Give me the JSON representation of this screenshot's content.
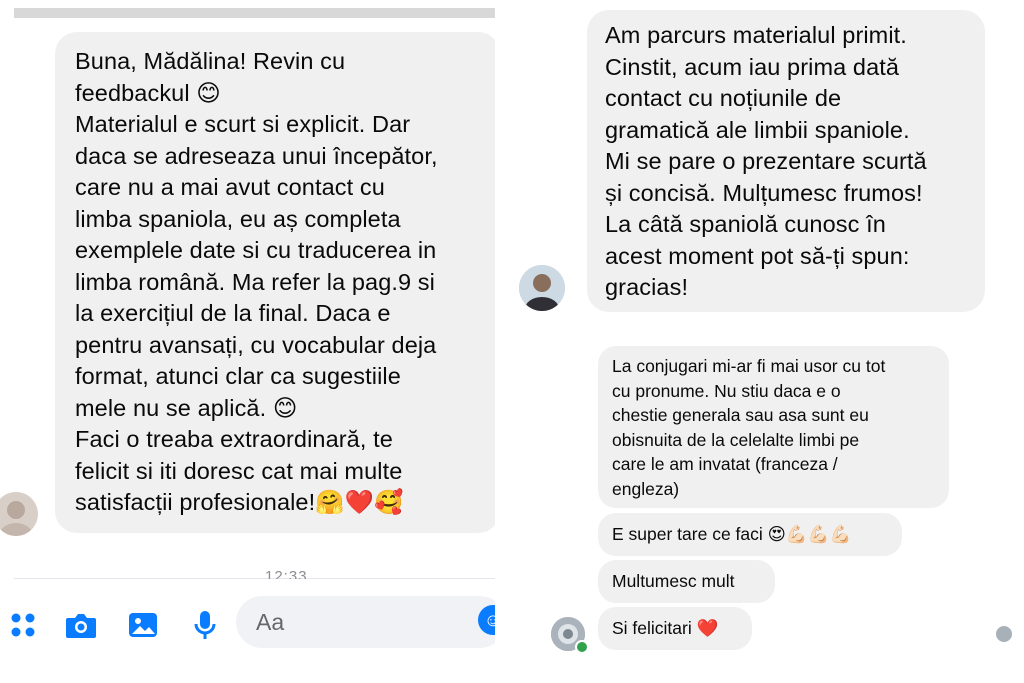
{
  "left_panel": {
    "message": "Buna, Mădălina! Revin cu\nfeedbackul 😊\nMaterialul e scurt si explicit. Dar\ndaca se adreseaza unui începător,\ncare nu a mai avut contact cu\nlimba spaniola, eu aș completa\nexemplele date si cu traducerea in\nlimba română. Ma refer la pag.9 si\nla exercițiul de la final. Daca e\npentru avansați, cu vocabular deja\nformat, atunci clar ca sugestiile\nmele nu se aplică. 😊\nFaci o treaba extraordinară, te\nfelicit si iti doresc cat mai multe\nsatisfacții profesionale!🤗❤️🥰",
    "timestamp": "12:33",
    "composer": {
      "placeholder": "Aa"
    },
    "toolbar_icons": [
      "apps-icon",
      "camera-icon",
      "image-icon",
      "microphone-icon",
      "emoji-icon"
    ]
  },
  "right_panel": {
    "message": "Am parcurs materialul primit.\nCinstit, acum iau prima dată\ncontact cu noțiunile de\ngramatică ale limbii spaniole.\nMi se pare o prezentare scurtă\nși concisă. Mulțumesc frumos!\nLa câtă spaniolă cunosc în\nacest moment pot să-ți spun:\ngracias!",
    "messages": [
      "La conjugari mi-ar fi mai usor cu tot\ncu pronume. Nu stiu daca e o\nchestie generala sau asa sunt eu\nobisnuita de la celelalte limbi pe\ncare le am invatat (franceza /\nengleza)",
      "E super tare ce faci 😍💪🏻💪🏻💪🏻",
      "Multumesc mult",
      "Si felicitari ❤️"
    ]
  },
  "colors": {
    "bubble": "#f0f0f0",
    "accent": "#0a7cff",
    "online": "#31a24c"
  }
}
